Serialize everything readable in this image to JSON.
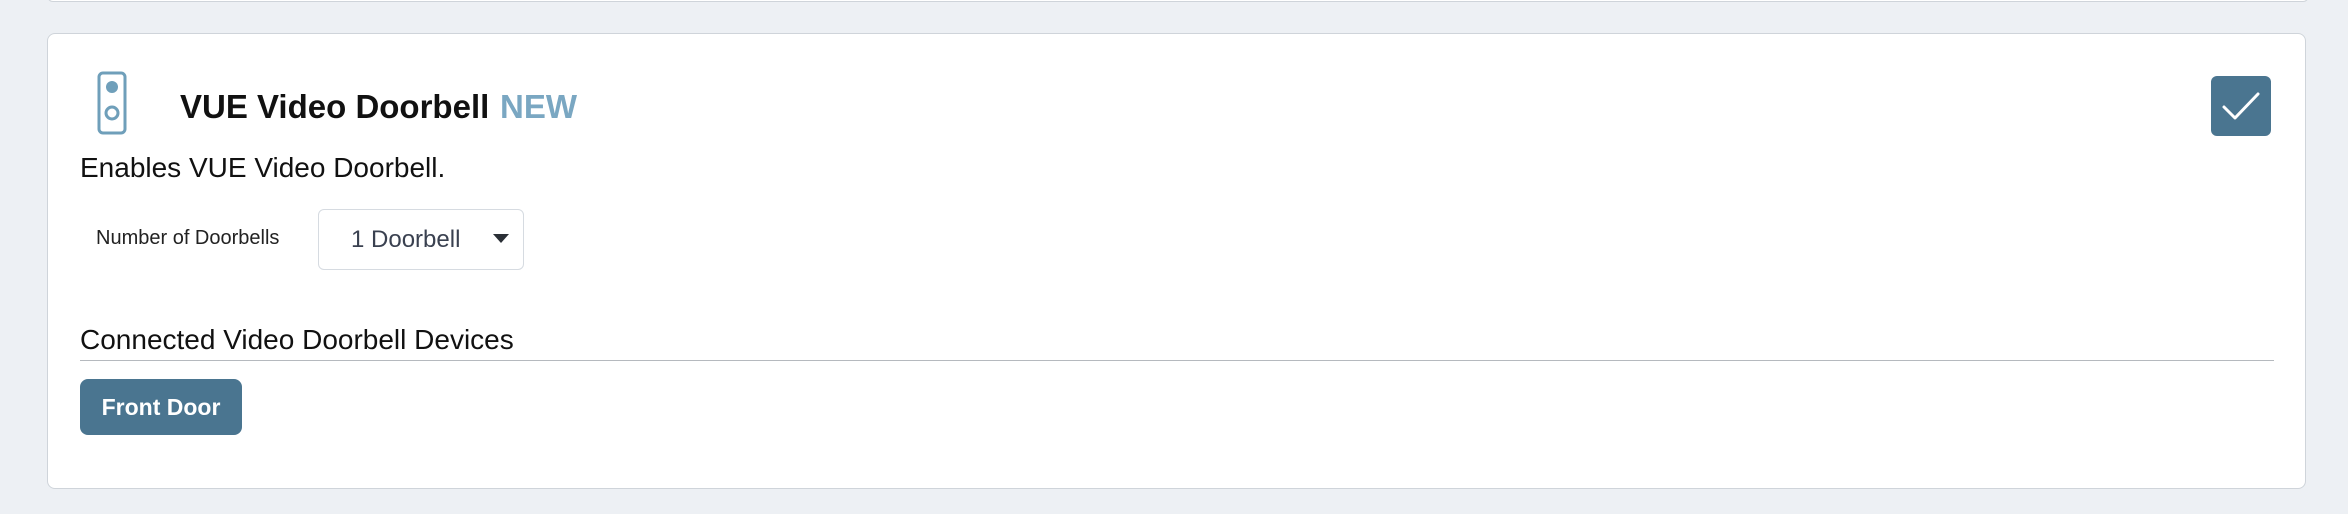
{
  "feature": {
    "icon": "doorbell-icon",
    "title": "VUE Video Doorbell",
    "badge": "NEW",
    "description": "Enables VUE Video Doorbell.",
    "enabled": true,
    "toggle_icon": "checkmark-icon"
  },
  "settings": {
    "doorbell_count": {
      "label": "Number of Doorbells",
      "selected": "1 Doorbell"
    }
  },
  "devices_section": {
    "title": "Connected Video Doorbell Devices",
    "devices": [
      {
        "label": "Front Door"
      }
    ]
  },
  "colors": {
    "accent": "#4a7590",
    "badge": "#7aa7c2",
    "icon": "#6f9fba",
    "background": "#edf0f4",
    "card": "#ffffff"
  }
}
